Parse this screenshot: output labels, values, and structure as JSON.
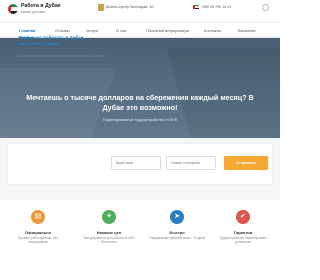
{
  "brand": {
    "title": "Работа в Дубае",
    "subtitle": "Найти для вас"
  },
  "header": {
    "address": "Бизнес-Центр Вилладжи, 10",
    "phone": "+380 99 796 15 41"
  },
  "nav": {
    "items": [
      {
        "label": "Главная",
        "active": true
      },
      {
        "label": "Отзывы",
        "active": false
      },
      {
        "label": "Услуги",
        "active": false
      },
      {
        "label": "О нас",
        "active": false
      },
      {
        "label": "Полезная информация",
        "active": false
      },
      {
        "label": "Контакты",
        "active": false
      },
      {
        "label": "Вакансии",
        "active": false
      }
    ]
  },
  "hero": {
    "title": "Мечтаешь о тысяче долларов на сбережения каждый месяц? В Дубае это возможно!",
    "subtitle": "Гарантированное трудоустройство от КПК"
  },
  "form": {
    "title": "Твой шанс работать в Дубае начинается здесь!",
    "note": "Оставьте заявку и мы с вами свяжемся в течение 15 минут",
    "name_placeholder": "Ваше имя",
    "phone_placeholder": "Номер телефона",
    "submit_label": "Отправить"
  },
  "features": [
    {
      "title": "Официально",
      "text": "Прямые работодатели, без посредников",
      "color": "#e89a3a",
      "icon": "document-icon"
    },
    {
      "title": "Никаких цен",
      "text": "Все документы для работы в ОАЭ бесплатно",
      "color": "#4cae5b",
      "icon": "price-tag-icon"
    },
    {
      "title": "Быстро",
      "text": "Оформление рабочей визы - 10 дней",
      "color": "#2a7fbf",
      "icon": "rocket-icon"
    },
    {
      "title": "Гарантии",
      "text": "Трудоустройство гарантировано договором",
      "color": "#e0554b",
      "icon": "shield-icon"
    }
  ],
  "colors": {
    "accent": "#2a7fbf",
    "button": "#f5a833",
    "hero": "#4a5d72"
  }
}
